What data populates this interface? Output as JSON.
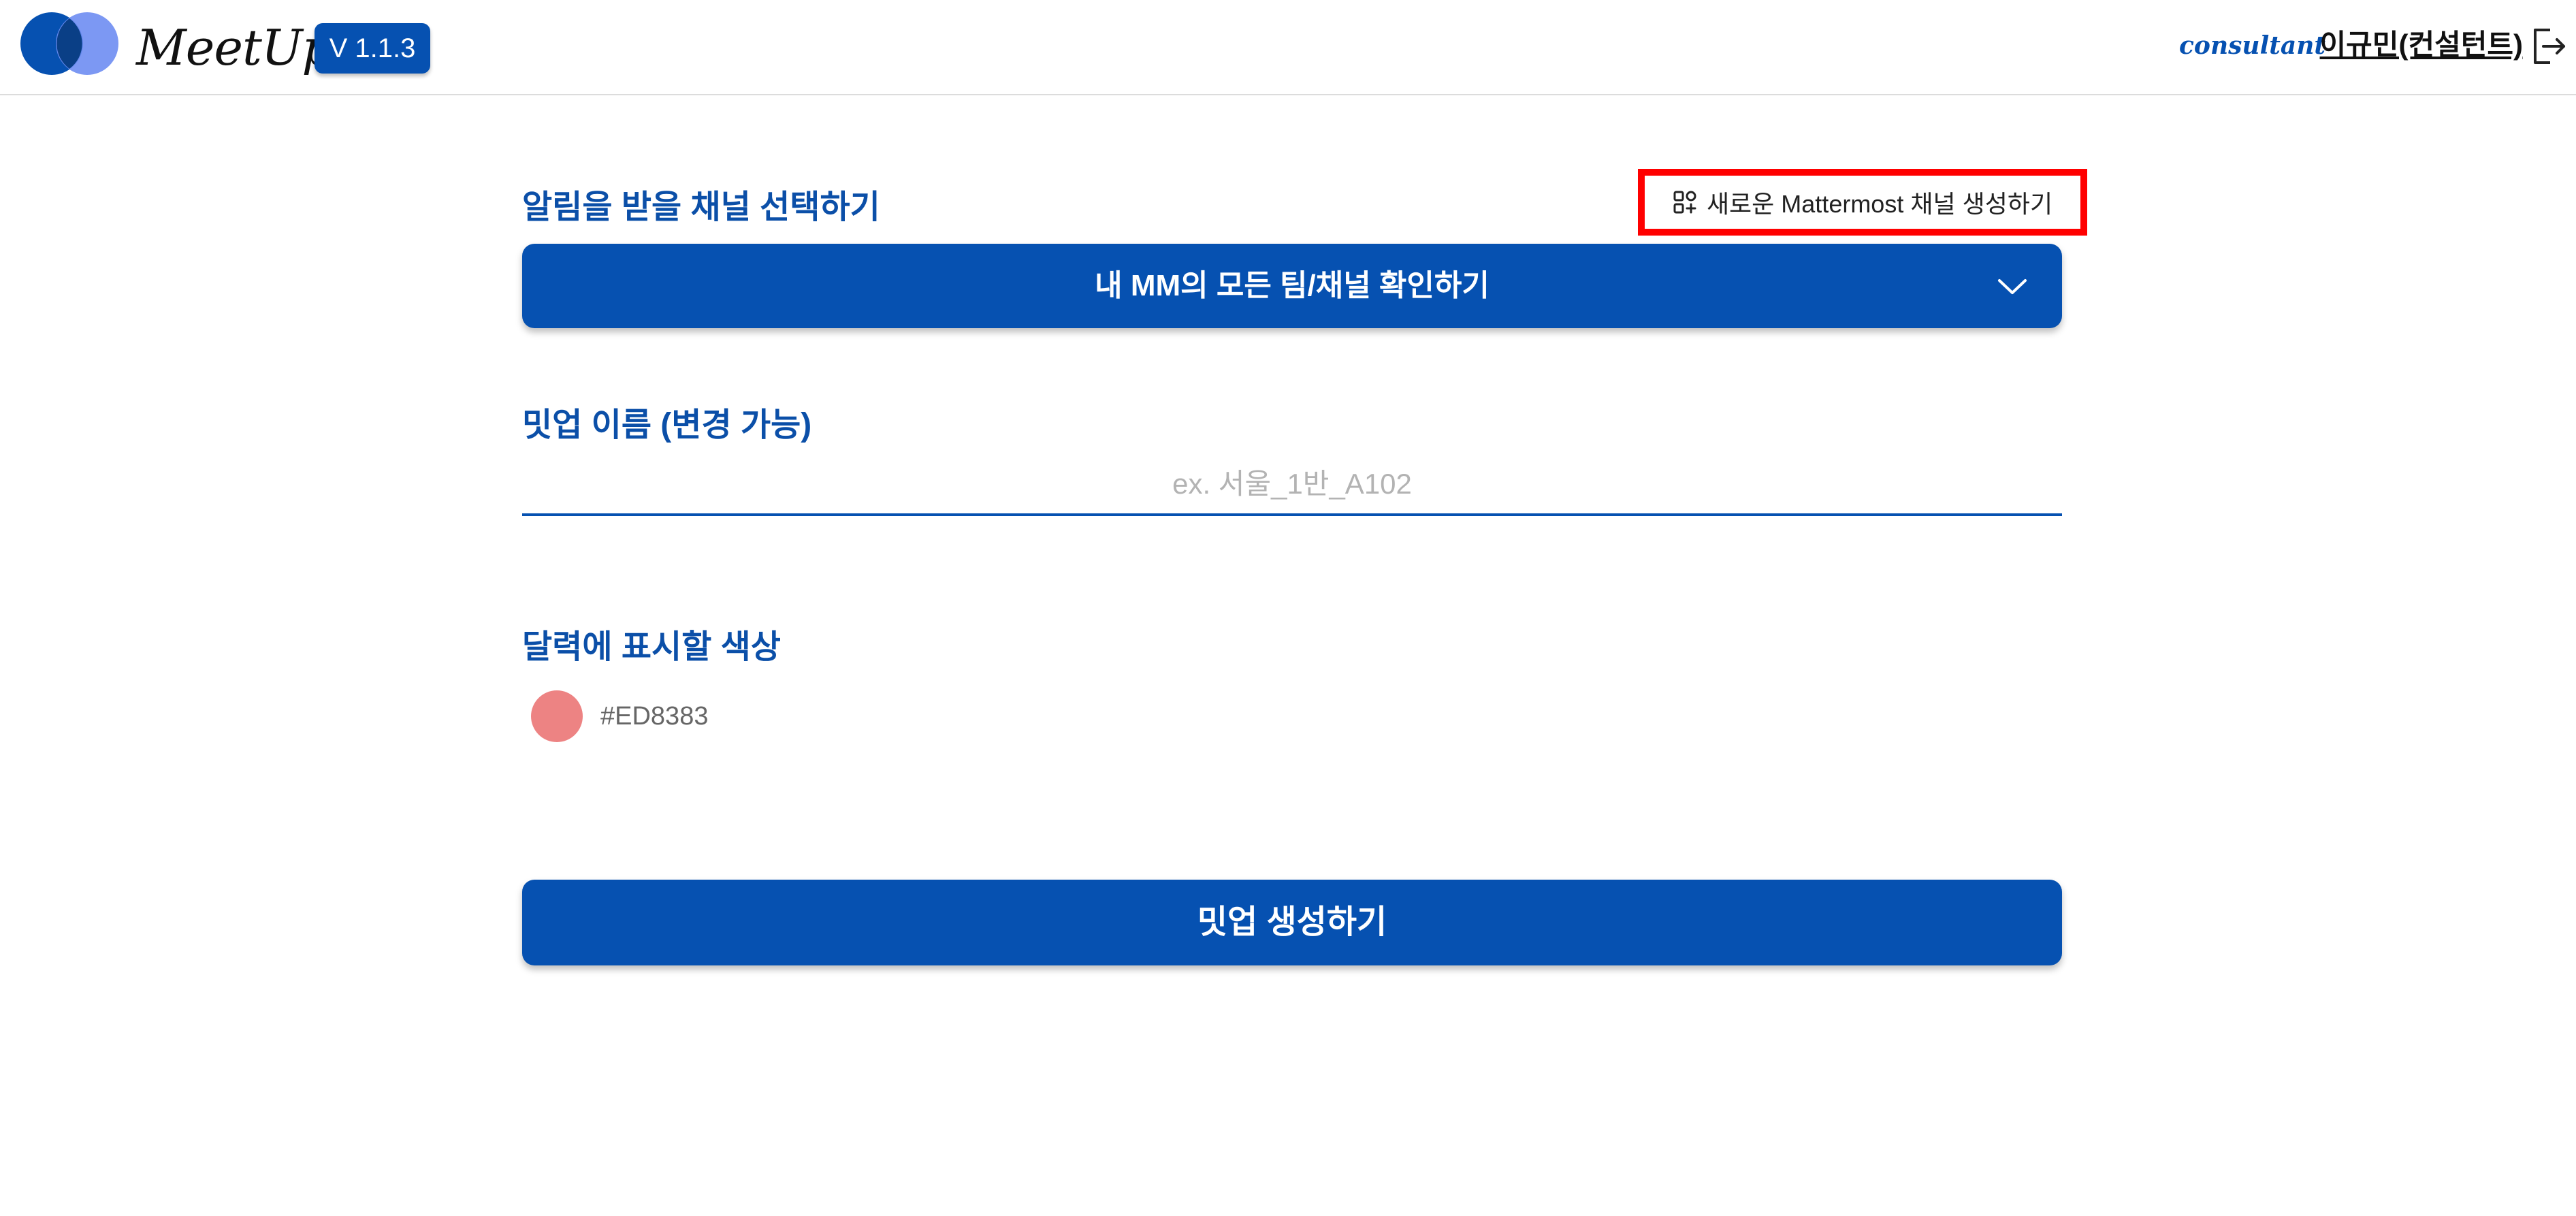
{
  "header": {
    "brand": "MeetUp",
    "version": "V 1.1.3",
    "role": "consultant",
    "user_name": "이규민(컨설턴트)"
  },
  "form": {
    "channel_section_label": "알림을 받을 채널 선택하기",
    "new_channel_button_label": "새로운 Mattermost 채널 생성하기",
    "channel_dropdown_label": "내 MM의 모든 팀/채널 확인하기",
    "name_section_label": "밋업 이름 (변경 가능)",
    "name_input": {
      "value": "",
      "placeholder": "ex. 서울_1반_A102"
    },
    "color_section_label": "달력에 표시할 색상",
    "color_hex": "#ED8383",
    "submit_button_label": "밋업 생성하기"
  },
  "colors": {
    "primary": "#0651B1",
    "highlight": "#FF0000",
    "selected_color": "#ED8383"
  },
  "icons": {
    "logo": "overlapping-circles-logo",
    "new_channel": "apps-grid-icon",
    "dropdown": "chevron-down-icon",
    "logout": "logout-icon"
  }
}
